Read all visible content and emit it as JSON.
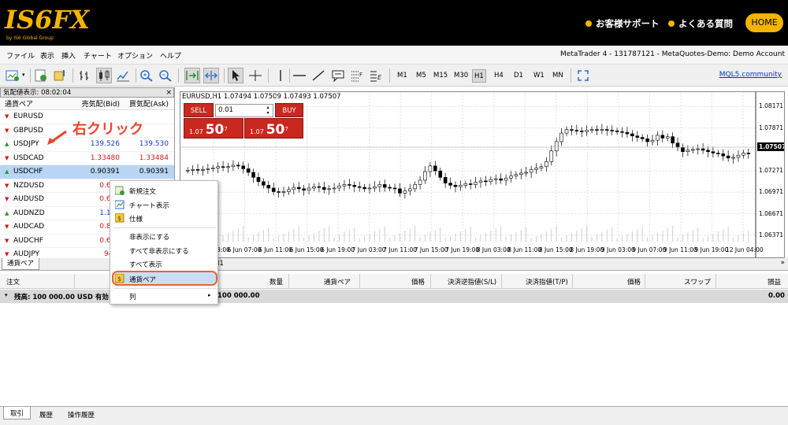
{
  "site": {
    "support_label": "お客様サポート",
    "faq_label": "よくある質問",
    "home_label": "HOME",
    "logo_tagline": "by IS6 Global Group"
  },
  "menu": [
    "ファイル",
    "表示",
    "挿入",
    "チャート",
    "オプション",
    "ヘルプ"
  ],
  "account_title": "MetaTrader 4 - 131787121 - MetaQuotes-Demo: Demo Account",
  "toolbar": {
    "timeframes": [
      "M1",
      "M5",
      "M15",
      "M30",
      "H1",
      "H4",
      "D1",
      "W1",
      "MN"
    ],
    "selected_timeframe": "H1",
    "mql_link": "MQL5.community"
  },
  "market_watch": {
    "title": "気配値表示: 08:02:04",
    "close": "×",
    "headers": [
      "通貨ペア",
      "売気配(Bid)",
      "買気配(Ask)"
    ],
    "rows": [
      {
        "symbol": "EURUSD",
        "bid": "",
        "ask": "",
        "dir": "down"
      },
      {
        "symbol": "GBPUSD",
        "bid": "",
        "ask": "",
        "dir": "down"
      },
      {
        "symbol": "USDJPY",
        "bid": "139.526",
        "ask": "139.530",
        "dir": "up",
        "color": "blue"
      },
      {
        "symbol": "USDCAD",
        "bid": "1.33480",
        "ask": "1.33484",
        "dir": "down",
        "color": "red"
      },
      {
        "symbol": "USDCHF",
        "bid": "0.90391",
        "ask": "0.90391",
        "dir": "up",
        "color": "black",
        "highlight": true
      },
      {
        "symbol": "NZDUSD",
        "bid": "0.611",
        "ask": "",
        "dir": "down",
        "color": "red"
      },
      {
        "symbol": "AUDUSD",
        "bid": "0.674",
        "ask": "",
        "dir": "down",
        "color": "red"
      },
      {
        "symbol": "AUDNZD",
        "bid": "1.102",
        "ask": "",
        "dir": "up",
        "color": "blue"
      },
      {
        "symbol": "AUDCAD",
        "bid": "0.899",
        "ask": "",
        "dir": "down",
        "color": "red"
      },
      {
        "symbol": "AUDCHF",
        "bid": "0.609",
        "ask": "",
        "dir": "down",
        "color": "red"
      },
      {
        "symbol": "AUDJPY",
        "bid": "94.0",
        "ask": "",
        "dir": "down",
        "color": "red"
      }
    ]
  },
  "annotation": "右クリック",
  "chart": {
    "title": "EURUSD,H1  1.07494 1.07509 1.07493 1.07507",
    "sell_label": "SELL",
    "buy_label": "BUY",
    "lot": "0.01",
    "sell_price_prefix": "1.07",
    "sell_price_big": "50",
    "sell_price_sup": "7",
    "buy_price_prefix": "1.07",
    "buy_price_big": "50",
    "buy_price_sup": "7",
    "current_price": "1.07507"
  },
  "chart_data": {
    "type": "candlestick",
    "symbol": "EURUSD",
    "timeframe": "H1",
    "x_tick_labels": [
      "6 Jun 03:00",
      "6 Jun 07:00",
      "6 Jun 11:00",
      "6 Jun 15:00",
      "6 Jun 19:00",
      "7 Jun 03:00",
      "7 Jun 11:00",
      "7 Jun 15:00",
      "7 Jun 19:00",
      "8 Jun 03:00",
      "8 Jun 11:00",
      "8 Jun 15:00",
      "8 Jun 19:00",
      "9 Jun 03:00",
      "9 Jun 07:00",
      "9 Jun 11:00",
      "9 Jun 19:00",
      "12 Jun 04:00"
    ],
    "y_tick_labels": [
      "1.08171",
      "1.07871",
      "1.07571",
      "1.07271",
      "1.06971",
      "1.06671",
      "1.06371"
    ],
    "ylim": [
      1.0628,
      1.0822
    ],
    "closes": [
      1.0728,
      1.0729,
      1.0728,
      1.0729,
      1.073,
      1.0731,
      1.0733,
      1.0732,
      1.0733,
      1.0735,
      1.0734,
      1.073,
      1.0725,
      1.0718,
      1.0712,
      1.0707,
      1.0703,
      1.0698,
      1.0697,
      1.0698,
      1.0701,
      1.0704,
      1.0702,
      1.07,
      1.0703,
      1.0705,
      1.0704,
      1.0701,
      1.0702,
      1.0703,
      1.0706,
      1.0708,
      1.0707,
      1.0705,
      1.0704,
      1.0702,
      1.0703,
      1.0705,
      1.0708,
      1.0704,
      1.0703,
      1.0702,
      1.0696,
      1.0699,
      1.0702,
      1.0708,
      1.0714,
      1.0726,
      1.0734,
      1.0727,
      1.0718,
      1.071,
      1.0707,
      1.0705,
      1.0707,
      1.0709,
      1.0708,
      1.0711,
      1.0713,
      1.0712,
      1.0715,
      1.0716,
      1.0714,
      1.0717,
      1.072,
      1.0722,
      1.0724,
      1.0725,
      1.0729,
      1.0731,
      1.0733,
      1.074,
      1.0755,
      1.0768,
      1.078,
      1.0785,
      1.0784,
      1.0783,
      1.0782,
      1.0784,
      1.0785,
      1.0784,
      1.0785,
      1.0784,
      1.0783,
      1.0782,
      1.0781,
      1.0779,
      1.0776,
      1.0774,
      1.0772,
      1.0768,
      1.077,
      1.0777,
      1.0773,
      1.0775,
      1.0766,
      1.076,
      1.0754,
      1.0756,
      1.0757,
      1.0758,
      1.0756,
      1.0754,
      1.0752,
      1.0751,
      1.0748,
      1.0745,
      1.0746,
      1.0749,
      1.0752,
      1.0751
    ],
    "show_volume": true,
    "grid": true
  },
  "context_menu": {
    "items": [
      "新規注文",
      "チャート表示",
      "仕様",
      "非表示にする",
      "すべて非表示にする",
      "すべて表示",
      "通貨ペア",
      "列"
    ],
    "highlighted": "通貨ペア"
  },
  "tabs": {
    "market_watch_tab": "通貨ペア",
    "chart_tab": "H1",
    "more": "»"
  },
  "terminal": {
    "headers": [
      "注文",
      "/",
      "数量",
      "通貨ペア",
      "価格",
      "決済逆指値(S/L)",
      "決済指値(T/P)",
      "価格",
      "スワップ",
      "損益"
    ],
    "balance_label": "残高: 100 000.00 USD  有効",
    "balance_tail": "100 000.00",
    "balance_pl": "0.00"
  },
  "bottom_tabs": [
    "取引",
    "履歴",
    "操作履歴"
  ]
}
